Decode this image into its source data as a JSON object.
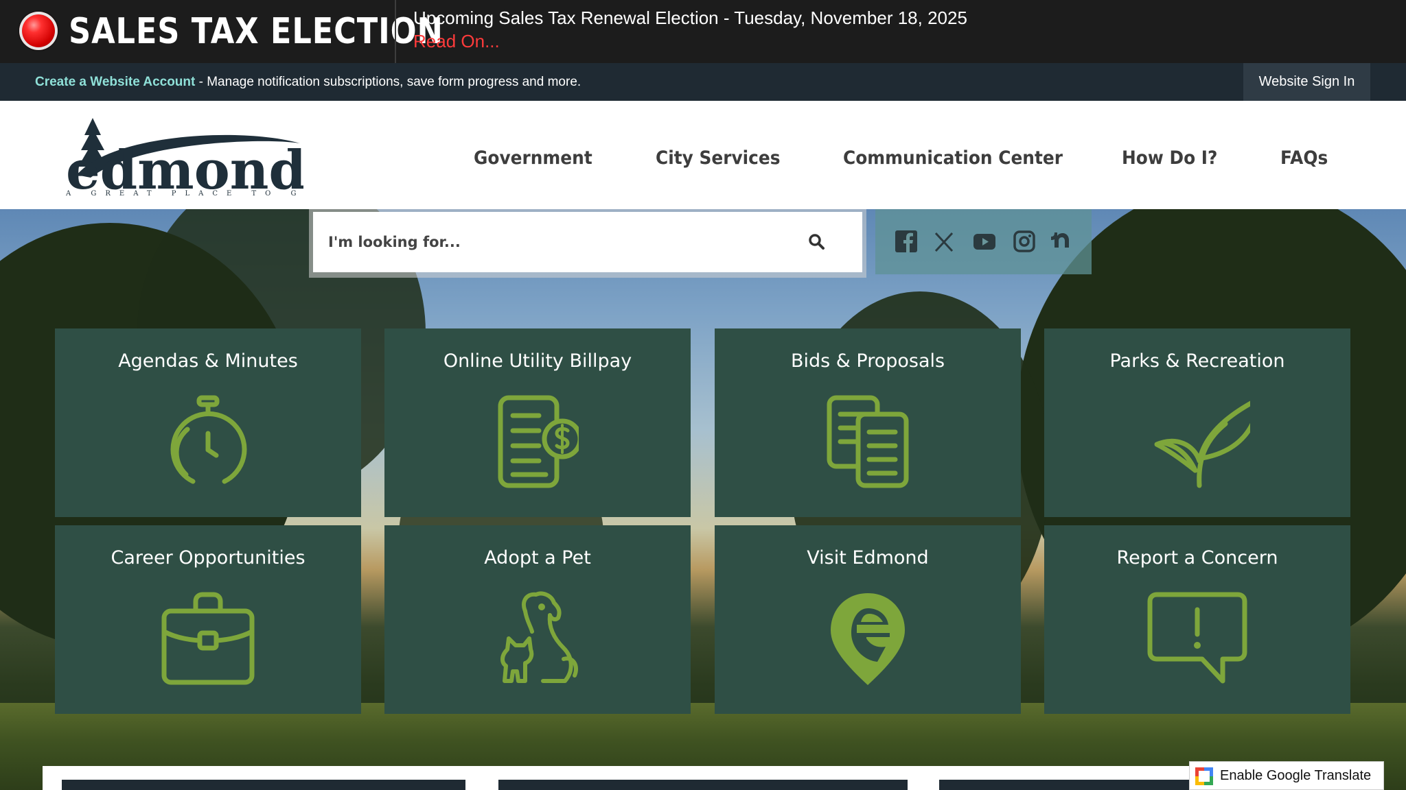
{
  "alert": {
    "title": "SALES TAX ELECTION",
    "message": "Upcoming Sales Tax Renewal Election - Tuesday, November 18, 2025",
    "link": "Read On..."
  },
  "account_bar": {
    "create_link": "Create a Website Account",
    "description": " - Manage notification subscriptions, save form progress and more.",
    "sign_in": "Website Sign In"
  },
  "logo": {
    "name": "edmond",
    "tagline": "A GREAT PLACE TO GROW"
  },
  "nav": [
    "Government",
    "City Services",
    "Communication Center",
    "How Do I?",
    "FAQs"
  ],
  "search": {
    "placeholder": "I'm looking for..."
  },
  "social": [
    "facebook-icon",
    "x-icon",
    "youtube-icon",
    "instagram-icon",
    "nextdoor-icon"
  ],
  "tiles": [
    {
      "label": "Agendas & Minutes",
      "icon": "stopwatch-icon"
    },
    {
      "label": "Online Utility Billpay",
      "icon": "bill-dollar-icon"
    },
    {
      "label": "Bids & Proposals",
      "icon": "documents-icon"
    },
    {
      "label": "Parks & Recreation",
      "icon": "sprout-icon"
    },
    {
      "label": "Career Opportunities",
      "icon": "briefcase-icon"
    },
    {
      "label": "Adopt a Pet",
      "icon": "dog-cat-icon"
    },
    {
      "label": "Visit Edmond",
      "icon": "location-e-icon"
    },
    {
      "label": "Report a Concern",
      "icon": "alert-speech-bubble-icon"
    }
  ],
  "translate": {
    "label": "Enable Google Translate"
  },
  "colors": {
    "alert_bg": "#1c1c1c",
    "alert_link": "#ff3b3b",
    "account_bg": "#1f2a33",
    "account_link": "#8fe0d8",
    "tile_bg": "#2f4f45",
    "icon_green": "#7ea63b",
    "logo_navy": "#1f2f3a"
  }
}
